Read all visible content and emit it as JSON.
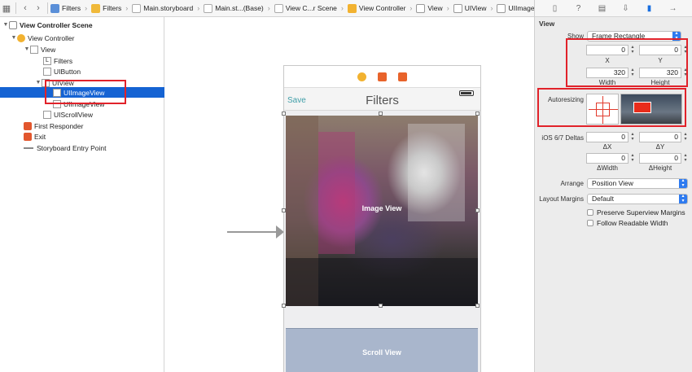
{
  "breadcrumbs": [
    {
      "label": "Filters",
      "icon": "file-icon"
    },
    {
      "label": "Filters",
      "icon": "folder-icon"
    },
    {
      "label": "Main.storyboard",
      "icon": "storyboard-icon"
    },
    {
      "label": "Main.st...(Base)",
      "icon": "storyboard-icon"
    },
    {
      "label": "View C...r Scene",
      "icon": "scene-icon"
    },
    {
      "label": "View Controller",
      "icon": "view-controller-icon"
    },
    {
      "label": "View",
      "icon": "view-icon"
    },
    {
      "label": "UIView",
      "icon": "view-icon"
    },
    {
      "label": "UIImageView",
      "icon": "imageview-icon"
    }
  ],
  "outline": {
    "items": [
      {
        "label": "View Controller Scene"
      },
      {
        "label": "View Controller"
      },
      {
        "label": "View"
      },
      {
        "label": "Filters"
      },
      {
        "label": "UIButton"
      },
      {
        "label": "UIView"
      },
      {
        "label": "UIImageView",
        "selected": true
      },
      {
        "label": "UIImageView"
      },
      {
        "label": "UIScrollView"
      },
      {
        "label": "First Responder"
      },
      {
        "label": "Exit"
      },
      {
        "label": "Storyboard Entry Point"
      }
    ]
  },
  "canvas": {
    "save_label": "Save",
    "title": "Filters",
    "image_view_label": "Image View",
    "scroll_view_label": "Scroll View"
  },
  "inspector": {
    "section_title": "View",
    "show_label": "Show",
    "show_value": "Frame Rectangle",
    "x_value": "0",
    "x_label": "X",
    "y_value": "0",
    "y_label": "Y",
    "width_value": "320",
    "width_label": "Width",
    "height_value": "320",
    "height_label": "Height",
    "autoresizing_label": "Autoresizing",
    "deltas_label": "iOS 6/7 Deltas",
    "dx_value": "0",
    "dx_label": "ΔX",
    "dy_value": "0",
    "dy_label": "ΔY",
    "dw_value": "0",
    "dw_label": "ΔWidth",
    "dh_value": "0",
    "dh_label": "ΔHeight",
    "arrange_label": "Arrange",
    "arrange_value": "Position View",
    "margins_label": "Layout Margins",
    "margins_value": "Default",
    "preserve_label": "Preserve Superview Margins",
    "readable_label": "Follow Readable Width"
  },
  "colors": {
    "selection": "#1563d3",
    "highlight_box": "#e1222a",
    "accent": "#3f9ea8"
  }
}
